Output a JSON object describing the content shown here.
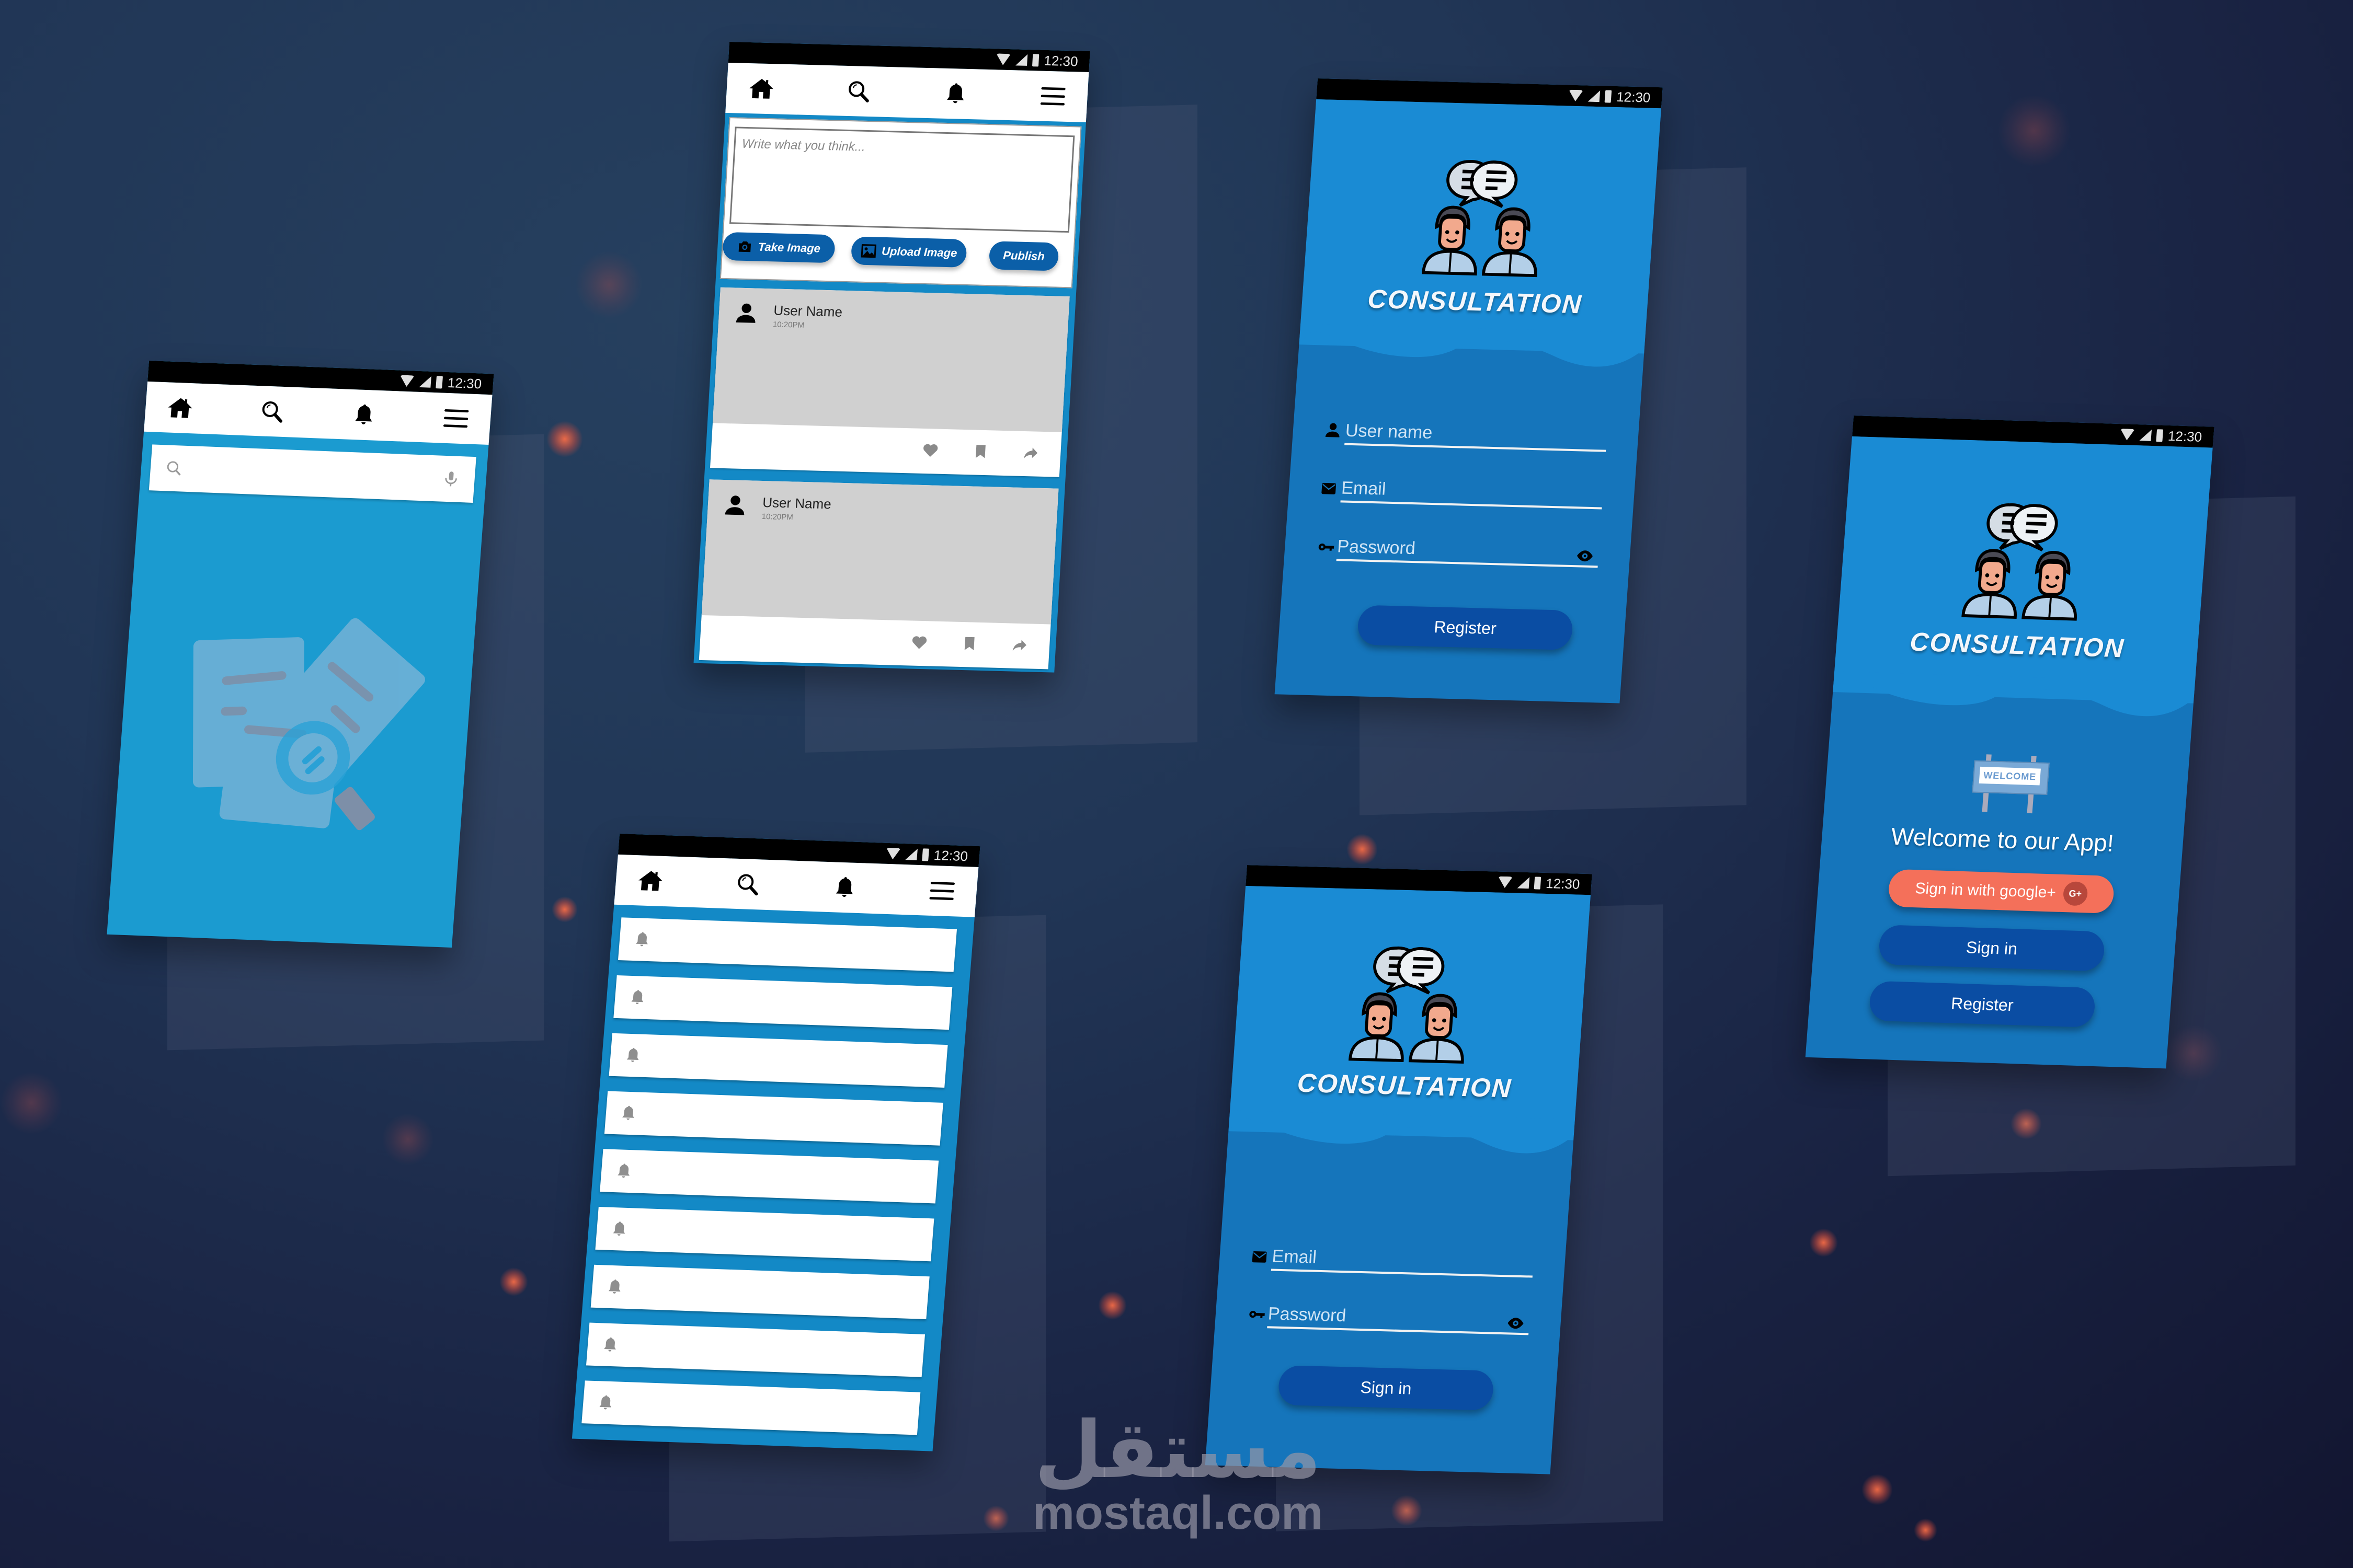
{
  "status_bar": {
    "time": "12:30"
  },
  "nav": {
    "icons": [
      "home-icon",
      "search-icon",
      "bell-icon",
      "hamburger-menu-icon"
    ]
  },
  "screens": {
    "search": {
      "search_placeholder": "",
      "empty_state_icon": "documents-magnifier-illustration"
    },
    "feed": {
      "compose_placeholder": "Write what you think...",
      "take_image_label": "Take Image",
      "upload_image_label": "Upload Image",
      "publish_label": "Publish",
      "posts": [
        {
          "user": "User Name",
          "time": "10:20PM"
        },
        {
          "user": "User Name",
          "time": "10:20PM"
        }
      ]
    },
    "register": {
      "title": "CONSULTATION",
      "username_label": "User name",
      "email_label": "Email",
      "password_label": "Password",
      "register_label": "Register"
    },
    "signin": {
      "title": "CONSULTATION",
      "email_label": "Email",
      "password_label": "Password",
      "signin_label": "Sign in"
    },
    "welcome": {
      "title": "CONSULTATION",
      "sign_text": "WELCOME",
      "headline": "Welcome to our App!",
      "google_label": "Sign in with google+",
      "google_badge": "G+",
      "signin_label": "Sign in",
      "register_label": "Register"
    },
    "notifications": {
      "count": 9
    }
  },
  "colors": {
    "primary_blue": "#1a8bd4",
    "dark_button": "#0a4da3",
    "google_button": "#f4705a",
    "background": "#213656"
  },
  "watermark": {
    "arabic": "مستقل",
    "latin": "mostaql.com"
  }
}
